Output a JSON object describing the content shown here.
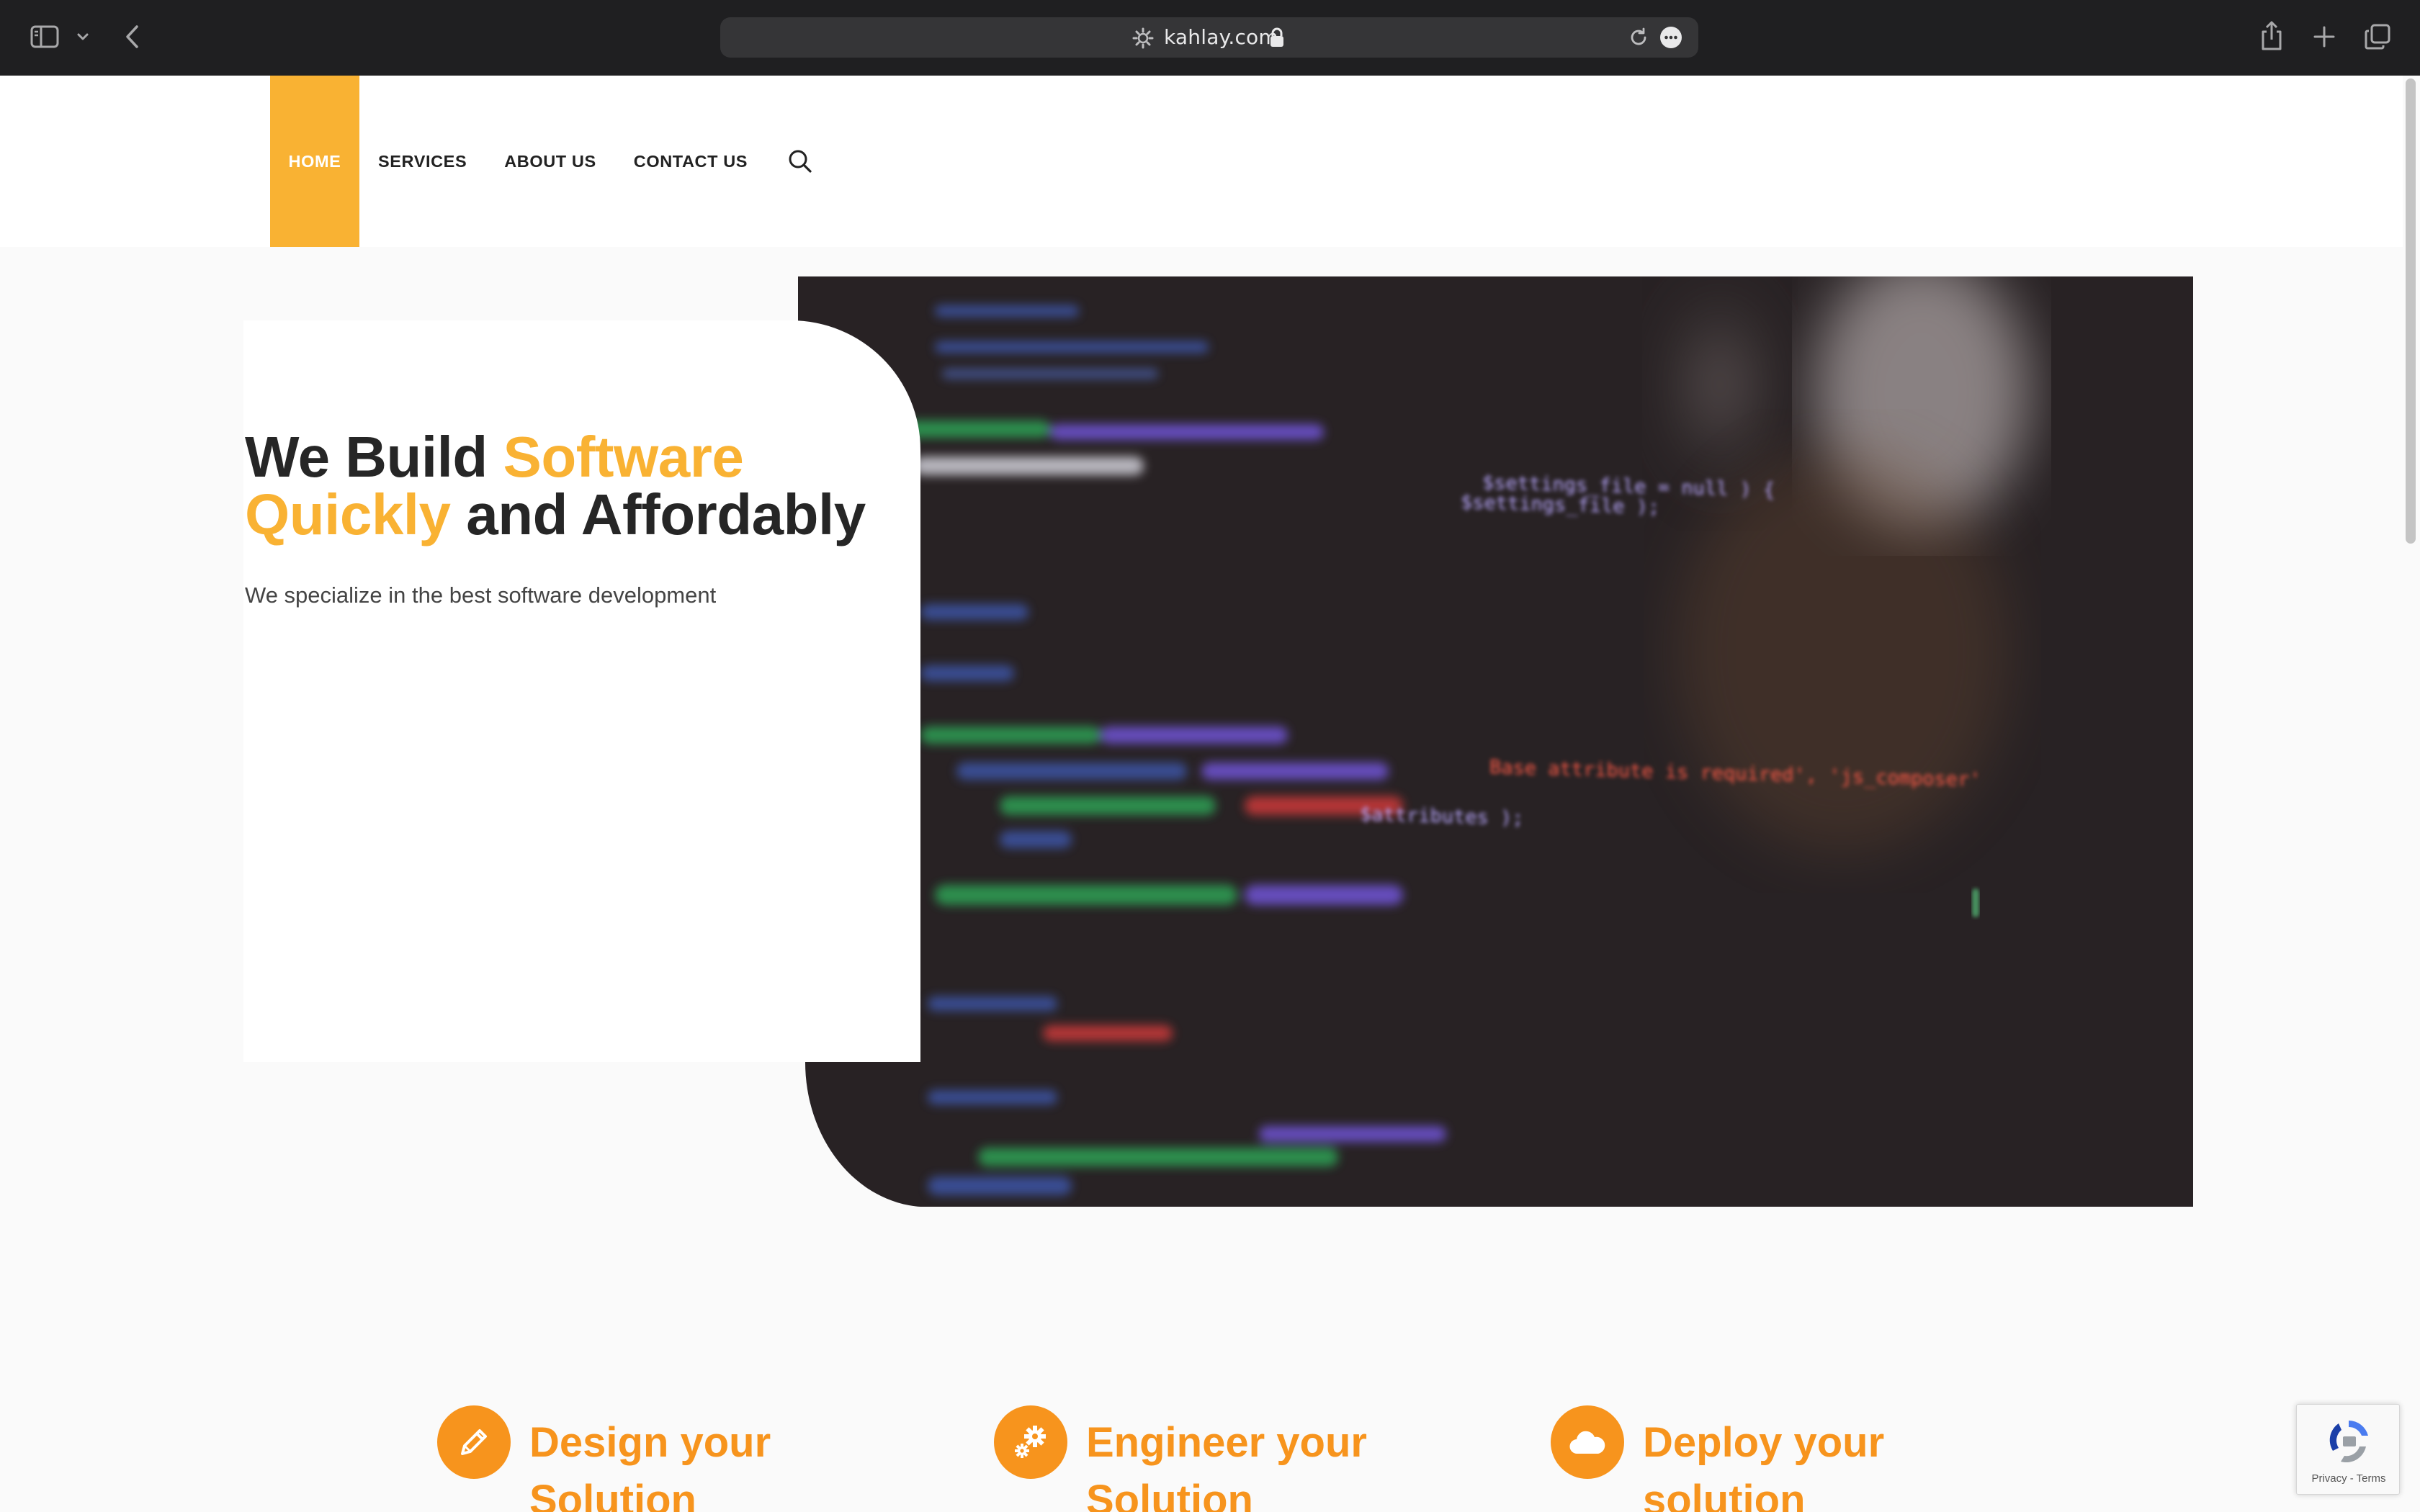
{
  "browser": {
    "url": "kahlay.com",
    "icons": [
      "sidebar-icon",
      "chevron-down-icon",
      "back-icon",
      "site-settings-icon",
      "lock-icon",
      "reload-icon",
      "more-icon",
      "share-icon",
      "new-tab-icon",
      "tabs-overview-icon"
    ]
  },
  "nav": {
    "items": [
      {
        "label": "HOME",
        "active": true
      },
      {
        "label": "SERVICES",
        "active": false
      },
      {
        "label": "ABOUT US",
        "active": false
      },
      {
        "label": "CONTACT US",
        "active": false
      }
    ],
    "search_icon": "search-icon"
  },
  "hero": {
    "title_part1": "We Build ",
    "title_accent1": "Software",
    "title_accent2": "Quickly",
    "title_part2": " and Affordably",
    "subtitle": "We specialize in the best software development",
    "image": {
      "lines": [
        "$settings_file = null ) {",
        "$settings_file );",
        "Base attribute is required', 'js_composer'",
        "$attributes );"
      ]
    }
  },
  "features": [
    {
      "title": "Design your Solution",
      "icon": "pencil-icon"
    },
    {
      "title": "Engineer your Solution",
      "icon": "gears-icon"
    },
    {
      "title": "Deploy your solution",
      "icon": "cloud-icon"
    }
  ],
  "recaptcha": {
    "terms": "Privacy - Terms"
  },
  "colors": {
    "accent": "#f9b233",
    "feature_orange": "#f7941d",
    "chrome": "#1f1f21",
    "text_dark": "#262626"
  }
}
